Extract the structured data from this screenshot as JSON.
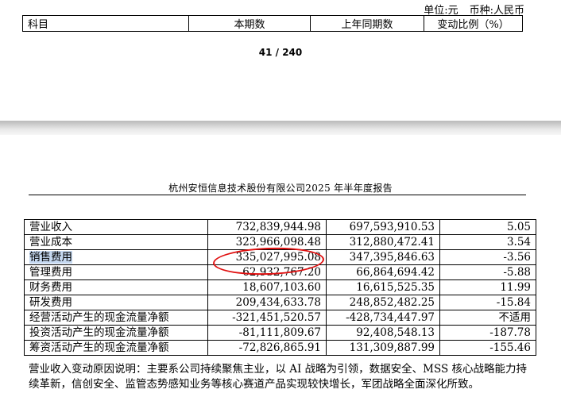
{
  "unit_line": {
    "unit": "单位:元",
    "currency": "币种:人民币"
  },
  "top_header": [
    "科目",
    "本期数",
    "上年同期数",
    "变动比例（%）"
  ],
  "page_number": "41 / 240",
  "report_title": "杭州安恒信息技术股份有限公司2025 年半年度报告",
  "rows": [
    {
      "label": "营业收入",
      "current": "732,839,944.98",
      "previous": "697,593,910.53",
      "ratio": "5.05"
    },
    {
      "label": "营业成本",
      "current": "323,966,098.48",
      "previous": "312,880,472.41",
      "ratio": "3.54"
    },
    {
      "label": "销售费用",
      "current": "335,027,995.08",
      "previous": "347,395,846.63",
      "ratio": "-3.56"
    },
    {
      "label": "管理费用",
      "current": "62,932,767.20",
      "previous": "66,864,694.42",
      "ratio": "-5.88"
    },
    {
      "label": "财务费用",
      "current": "18,607,103.60",
      "previous": "16,615,525.35",
      "ratio": "11.99"
    },
    {
      "label": "研发费用",
      "current": "209,434,633.78",
      "previous": "248,852,482.25",
      "ratio": "-15.84"
    },
    {
      "label": "经营活动产生的现金流量净额",
      "current": "-321,451,520.57",
      "previous": "-428,734,447.97",
      "ratio": "不适用"
    },
    {
      "label": "投资活动产生的现金流量净额",
      "current": "-81,111,809.67",
      "previous": "92,408,548.13",
      "ratio": "-187.78"
    },
    {
      "label": "筹资活动产生的现金流量净额",
      "current": "-72,826,865.91",
      "previous": "131,309,887.99",
      "ratio": "-155.46"
    }
  ],
  "explanation": "营业收入变动原因说明：主要系公司持续聚焦主业，以 AI 战略为引领，数据安全、MSS 核心战略能力持续革新，信创安全、监管态势感知业务等核心赛道产品实现较快增长，军团战略全面深化所致。",
  "colors": {
    "highlight": "#c6d9f1",
    "annotation": "#e01010"
  }
}
